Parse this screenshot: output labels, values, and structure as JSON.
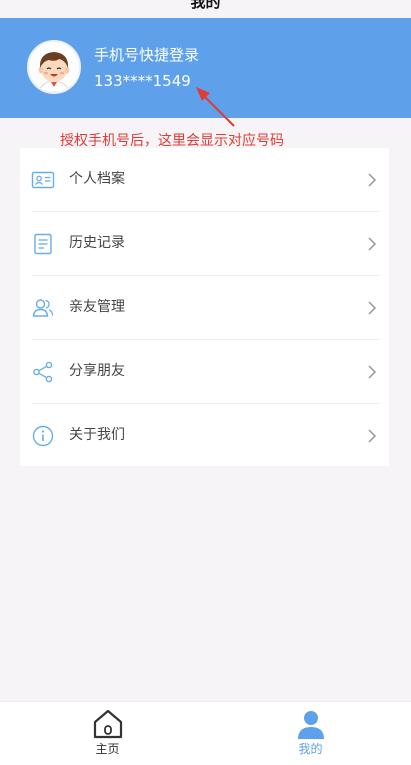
{
  "page": {
    "title": "我的"
  },
  "user": {
    "title": "手机号快捷登录",
    "phone": "133****1549"
  },
  "annotation": {
    "text": "授权手机号后，这里会显示对应号码",
    "color": "#e03b36"
  },
  "menu": {
    "items": [
      {
        "label": "个人档案",
        "icon": "id-card-icon"
      },
      {
        "label": "历史记录",
        "icon": "document-icon"
      },
      {
        "label": "亲友管理",
        "icon": "users-icon"
      },
      {
        "label": "分享朋友",
        "icon": "share-icon"
      },
      {
        "label": "关于我们",
        "icon": "info-icon"
      }
    ]
  },
  "tabbar": {
    "tabs": [
      {
        "label": "主页",
        "icon": "home-icon",
        "color": "#333333"
      },
      {
        "label": "我的",
        "icon": "user-icon",
        "color": "#5ea1ea",
        "active": true
      }
    ]
  },
  "colors": {
    "header_bg": "#5ea1ea",
    "accent": "#5ea1ea",
    "icon": "#6aaee6"
  }
}
